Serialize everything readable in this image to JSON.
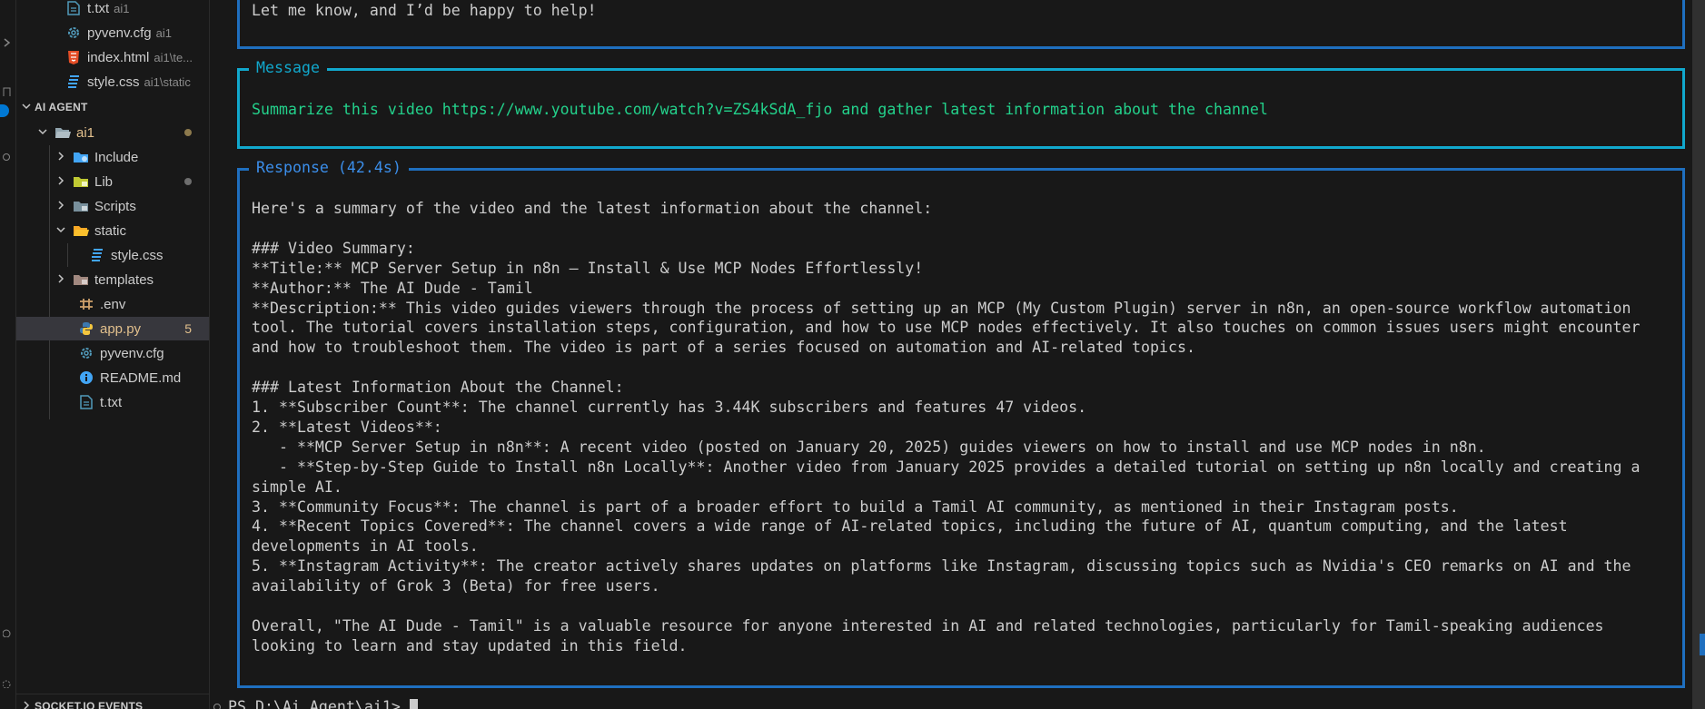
{
  "explorer": {
    "top_files": [
      {
        "name": "t.txt",
        "desc": "ai1",
        "icon": "text-file-icon"
      },
      {
        "name": "pyvenv.cfg",
        "desc": "ai1",
        "icon": "gear-icon"
      },
      {
        "name": "index.html",
        "desc": "ai1\\te...",
        "icon": "html-file-icon"
      },
      {
        "name": "style.css",
        "desc": "ai1\\static",
        "icon": "css-file-icon"
      }
    ],
    "project_section": "AI AGENT",
    "tree": [
      {
        "name": "ai1",
        "icon": "folder-open-icon"
      },
      {
        "name": "Include",
        "icon": "folder-icon"
      },
      {
        "name": "Lib",
        "icon": "folder-icon"
      },
      {
        "name": "Scripts",
        "icon": "folder-icon"
      },
      {
        "name": "static",
        "icon": "folder-open-icon"
      },
      {
        "name": "style.css",
        "icon": "css-file-icon"
      },
      {
        "name": "templates",
        "icon": "folder-icon"
      },
      {
        "name": ".env",
        "icon": "env-file-icon"
      },
      {
        "name": "app.py",
        "icon": "python-file-icon",
        "badge": "5"
      },
      {
        "name": "pyvenv.cfg",
        "icon": "gear-icon"
      },
      {
        "name": "README.md",
        "icon": "info-icon"
      },
      {
        "name": "t.txt",
        "icon": "text-file-icon"
      }
    ],
    "bottom_section": "SOCKET.IO EVENTS"
  },
  "terminal": {
    "prev_line": "Let me know, and I’d be happy to help!",
    "message_title": "Message",
    "message_text": "Summarize this video https://www.youtube.com/watch?v=ZS4kSdA_fjo and gather latest information about the channel",
    "response_title": "Response (42.4s)",
    "response_lines": [
      "Here's a summary of the video and the latest information about the channel:",
      "",
      "### Video Summary:",
      "**Title:** MCP Server Setup in n8n – Install & Use MCP Nodes Effortlessly!",
      "**Author:** The AI Dude - Tamil",
      "**Description:** This video guides viewers through the process of setting up an MCP (My Custom Plugin) server in n8n, an open-source workflow automation",
      "tool. The tutorial covers installation steps, configuration, and how to use MCP nodes effectively. It also touches on common issues users might encounter",
      "and how to troubleshoot them. The video is part of a series focused on automation and AI-related topics.",
      "",
      "### Latest Information About the Channel:",
      "1. **Subscriber Count**: The channel currently has 3.44K subscribers and features 47 videos.",
      "2. **Latest Videos**:",
      "   - **MCP Server Setup in n8n**: A recent video (posted on January 20, 2025) guides viewers on how to install and use MCP nodes in n8n.",
      "   - **Step-by-Step Guide to Install n8n Locally**: Another video from January 2025 provides a detailed tutorial on setting up n8n locally and creating a",
      "simple AI.",
      "3. **Community Focus**: The channel is part of a broader effort to build a Tamil AI community, as mentioned in their Instagram posts.",
      "4. **Recent Topics Covered**: The channel covers a wide range of AI-related topics, including the future of AI, quantum computing, and the latest",
      "developments in AI tools.",
      "5. **Instagram Activity**: The creator actively shares updates on platforms like Instagram, discussing topics such as Nvidia's CEO remarks on AI and the",
      "availability of Grok 3 (Beta) for free users.",
      "",
      "Overall, \"The AI Dude - Tamil\" is a valuable resource for anyone interested in AI and related technologies, particularly for Tamil-speaking audiences",
      "looking to learn and stay updated in this field."
    ],
    "prompt": "PS D:\\Ai_Agent\\ai1>"
  },
  "colors": {
    "panel_border": "#1f6fbf",
    "message_border": "#11a8cd",
    "message_text": "#23d18b",
    "title_text": "#3b8eea",
    "modified": "#e2c08d"
  }
}
